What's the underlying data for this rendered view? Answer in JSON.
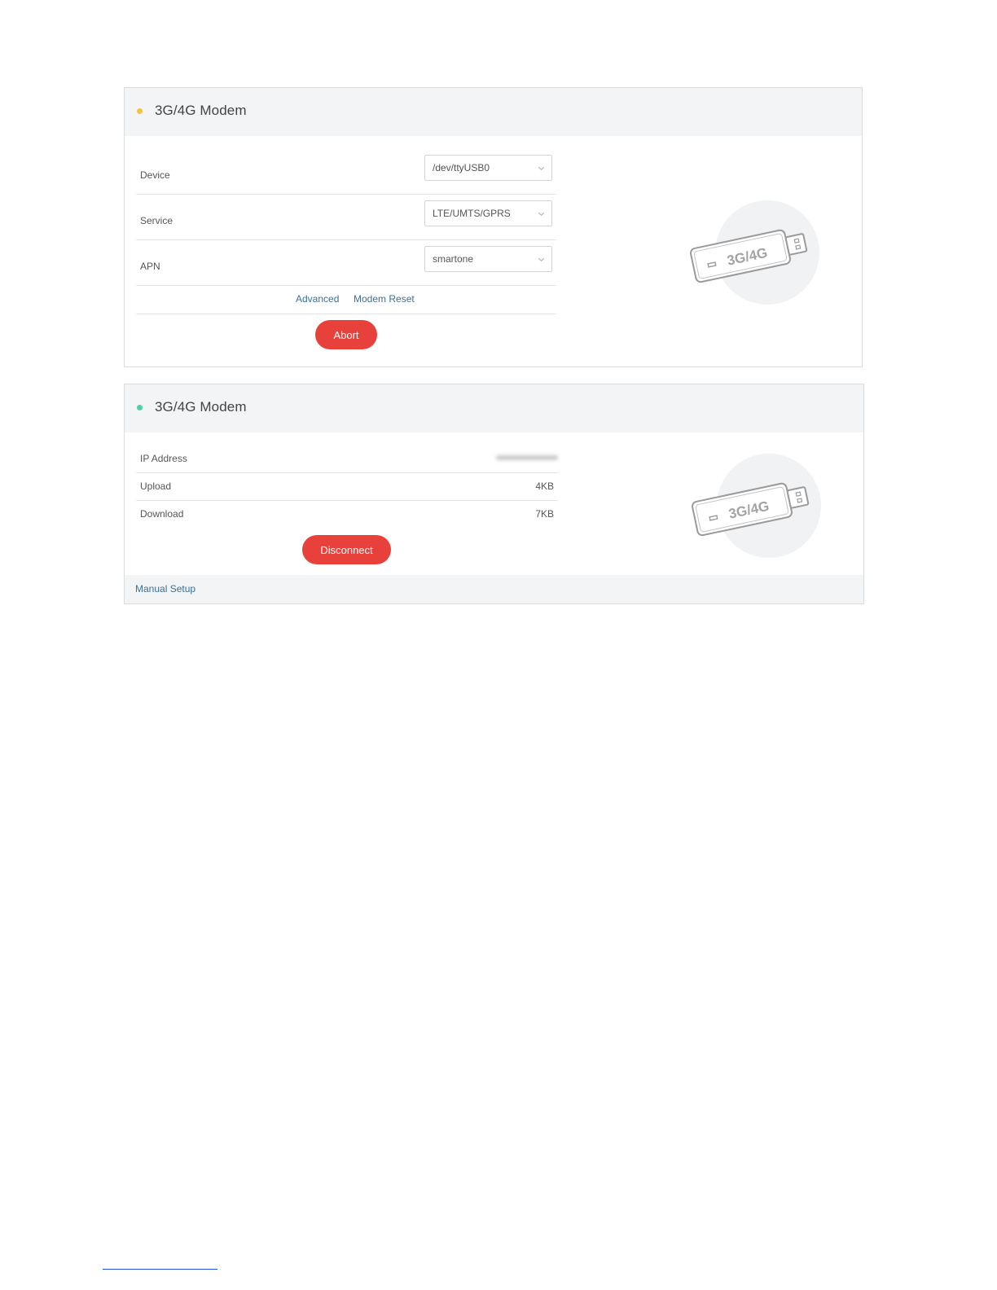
{
  "colors": {
    "status_pending": "#f5c33b",
    "status_connected": "#4fd1a5",
    "action_red": "#e8413b",
    "link_blue": "#3d6f98"
  },
  "panel_connecting": {
    "title": "3G/4G Modem",
    "status_icon": "status-dot-icon",
    "fields": [
      {
        "label": "Device",
        "value": "/dev/ttyUSB0"
      },
      {
        "label": "Service",
        "value": "LTE/UMTS/GPRS"
      },
      {
        "label": "APN",
        "value": "smartone"
      }
    ],
    "links": {
      "advanced": "Advanced",
      "modem_reset": "Modem Reset"
    },
    "abort_label": "Abort",
    "illustration_label": "3G/4G"
  },
  "panel_connected": {
    "title": "3G/4G Modem",
    "status_icon": "status-dot-icon",
    "stats": [
      {
        "label": "IP Address",
        "value": ""
      },
      {
        "label": "Upload",
        "value": "4KB"
      },
      {
        "label": "Download",
        "value": "7KB"
      }
    ],
    "disconnect_label": "Disconnect",
    "manual_setup_label": "Manual Setup",
    "illustration_label": "3G/4G"
  }
}
